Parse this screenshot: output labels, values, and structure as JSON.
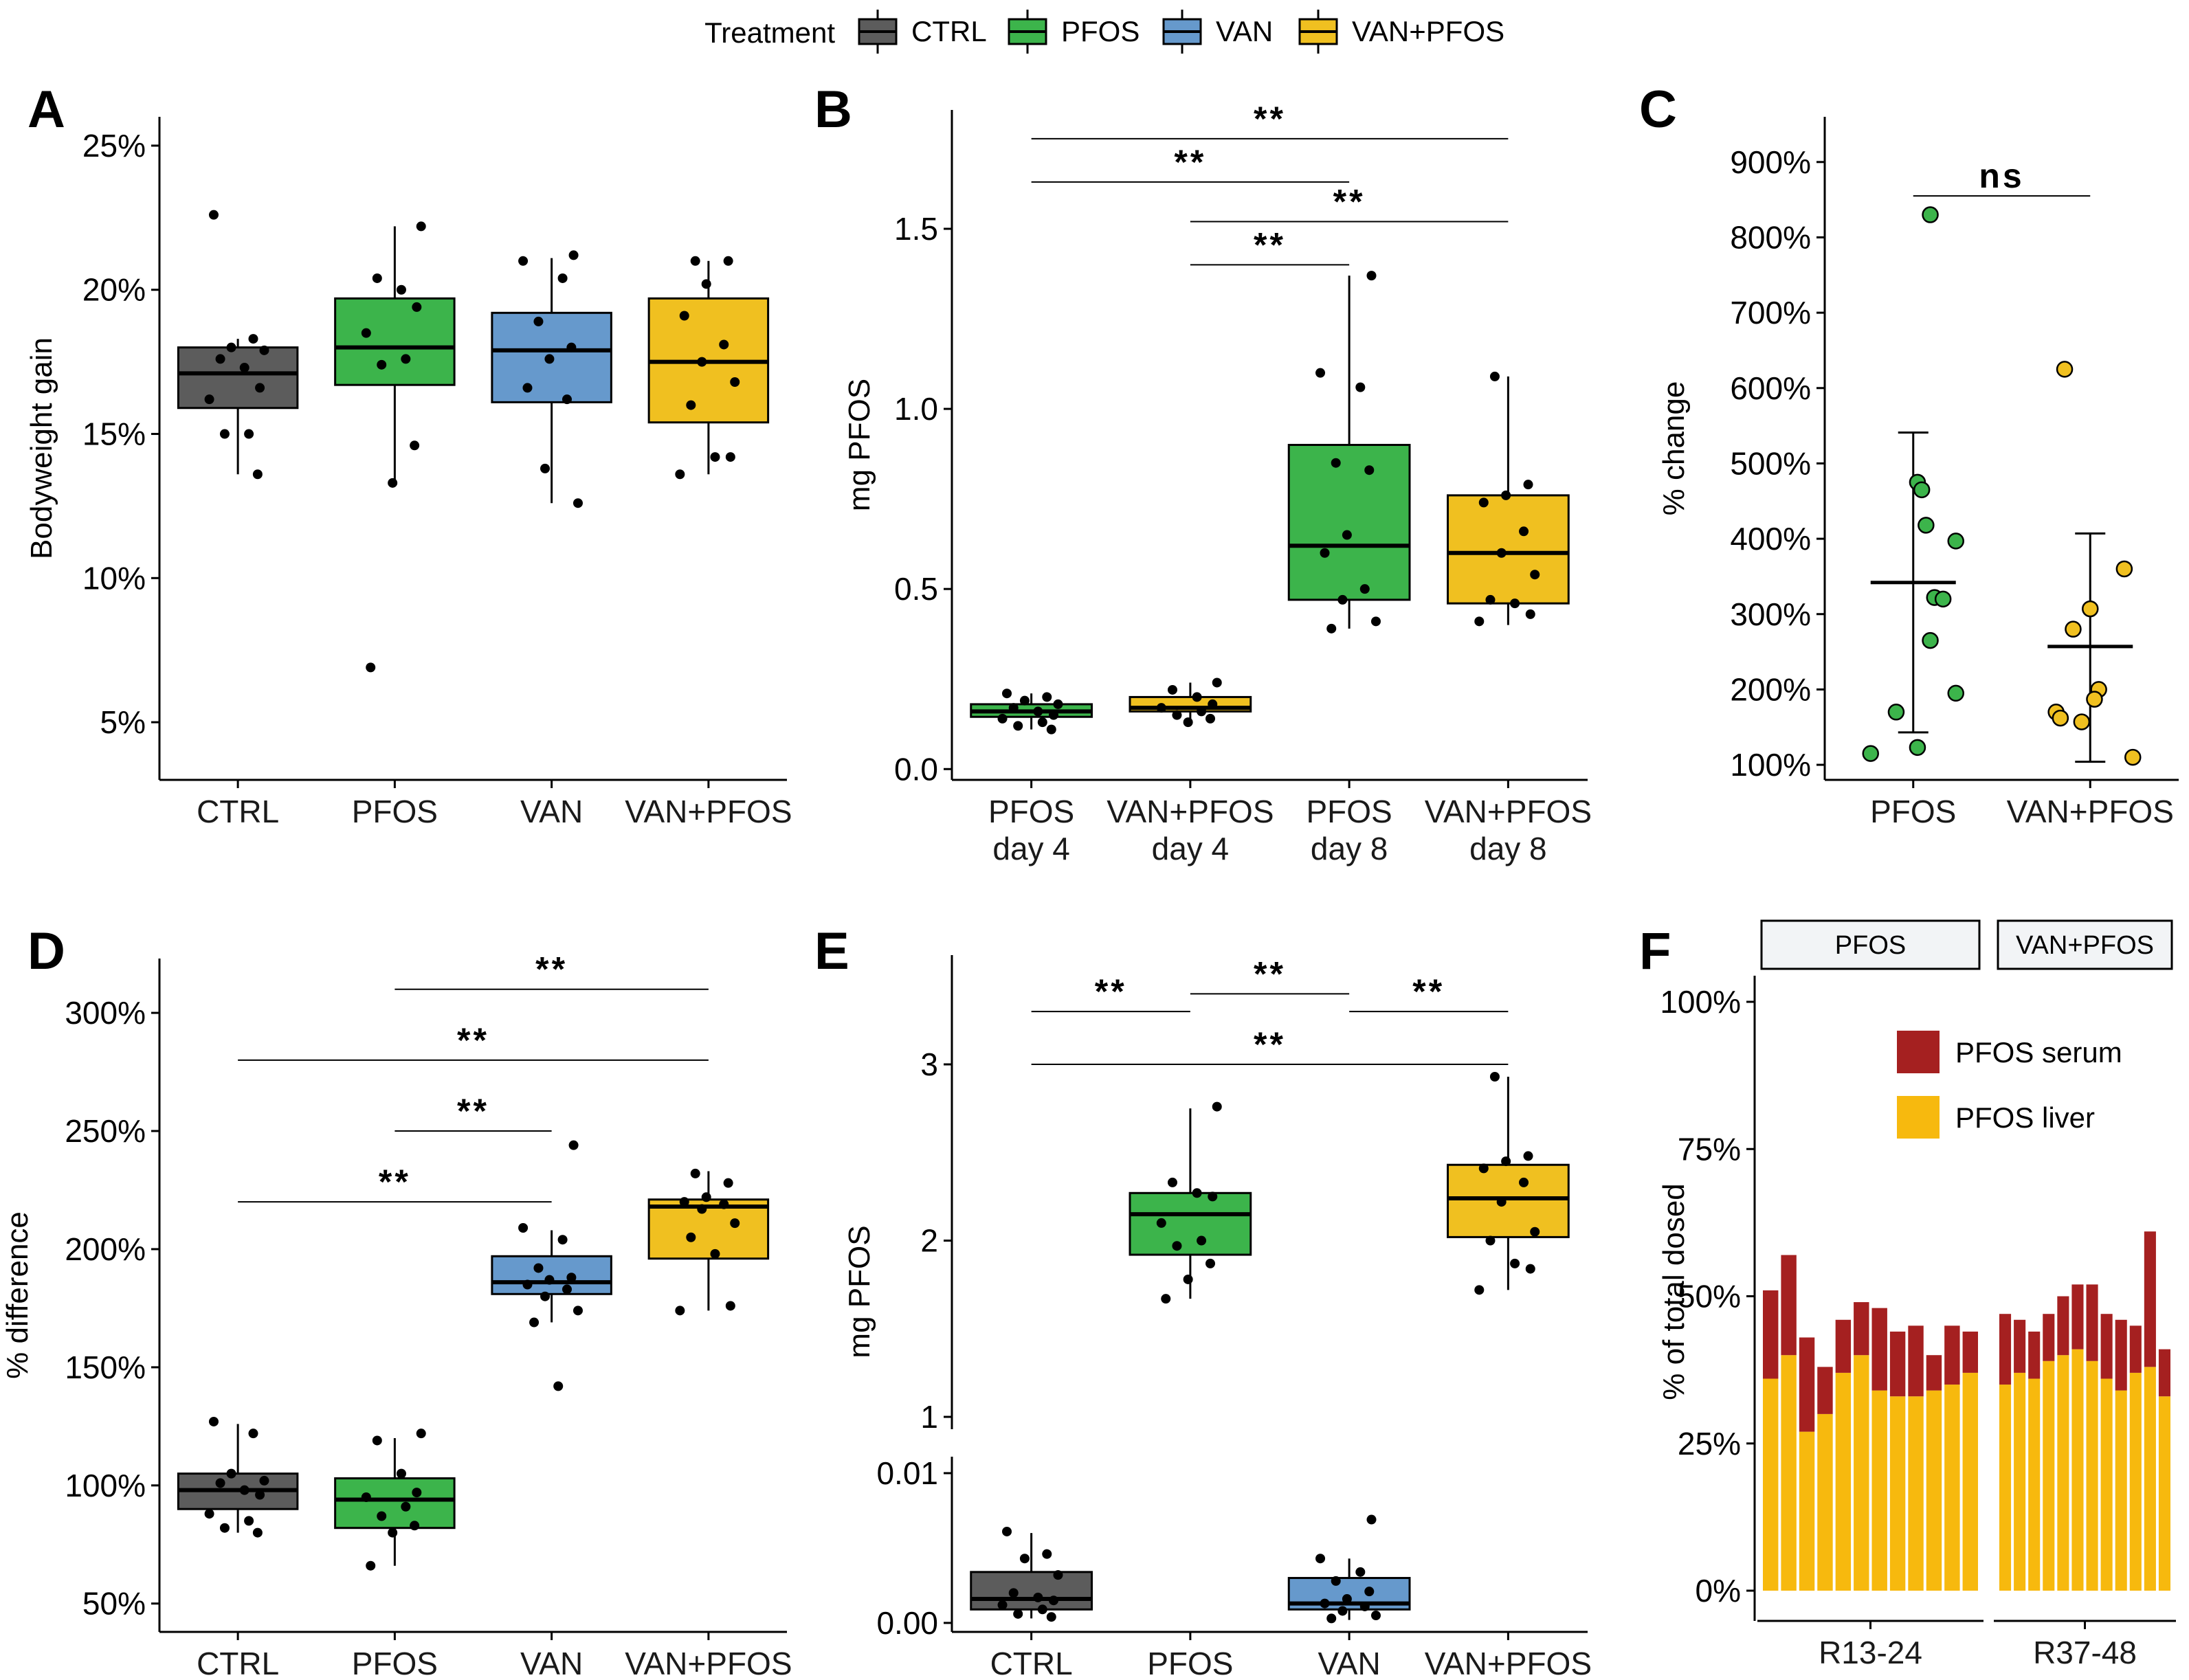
{
  "legend": {
    "title": "Treatment",
    "items": [
      {
        "label": "CTRL",
        "color": "#5c5c5c"
      },
      {
        "label": "PFOS",
        "color": "#3cb44b"
      },
      {
        "label": "VAN",
        "color": "#6699cc"
      },
      {
        "label": "VAN+PFOS",
        "color": "#f0c020"
      }
    ]
  },
  "chart_data": [
    {
      "panel": "A",
      "type": "box",
      "ylabel": "Bodyweight gain",
      "ylim": [
        3,
        26
      ],
      "yticks": [
        "5%",
        "10%",
        "15%",
        "20%",
        "25%"
      ],
      "ytick_values": [
        5,
        10,
        15,
        20,
        25
      ],
      "categories": [
        "CTRL",
        "PFOS",
        "VAN",
        "VAN+PFOS"
      ],
      "boxes": [
        {
          "q1": 15.9,
          "median": 17.1,
          "q3": 18.0,
          "lo": 13.6,
          "hi": 18.3,
          "fill": "#5c5c5c"
        },
        {
          "q1": 16.7,
          "median": 18.0,
          "q3": 19.7,
          "lo": 13.3,
          "hi": 22.2,
          "fill": "#3cb44b"
        },
        {
          "q1": 16.1,
          "median": 17.9,
          "q3": 19.2,
          "lo": 12.6,
          "hi": 21.1,
          "fill": "#6699cc"
        },
        {
          "q1": 15.4,
          "median": 17.5,
          "q3": 19.7,
          "lo": 13.6,
          "hi": 21.0,
          "fill": "#f0c020"
        }
      ],
      "points": [
        [
          22.6,
          18.3,
          18.0,
          17.9,
          17.6,
          17.3,
          16.6,
          16.2,
          15.0,
          15.0,
          13.6
        ],
        [
          22.2,
          20.4,
          20.0,
          19.4,
          18.5,
          17.6,
          17.4,
          14.6,
          13.3,
          6.9
        ],
        [
          21.2,
          21.0,
          20.4,
          18.9,
          18.0,
          17.6,
          16.6,
          16.2,
          13.8,
          12.6
        ],
        [
          21.0,
          21.0,
          20.2,
          19.1,
          18.1,
          17.5,
          16.8,
          16.0,
          14.2,
          14.2,
          13.6
        ]
      ],
      "significance": []
    },
    {
      "panel": "B",
      "type": "box",
      "ylabel": "mg PFOS",
      "ylim": [
        -0.03,
        1.83
      ],
      "yticks": [
        "0.0",
        "0.5",
        "1.0",
        "1.5"
      ],
      "ytick_values": [
        0.0,
        0.5,
        1.0,
        1.5
      ],
      "categories": [
        "PFOS\nday 4",
        "VAN+PFOS\nday 4",
        "PFOS\nday 8",
        "VAN+PFOS\nday 8"
      ],
      "boxes": [
        {
          "q1": 0.145,
          "median": 0.16,
          "q3": 0.18,
          "lo": 0.11,
          "hi": 0.21,
          "fill": "#3cb44b"
        },
        {
          "q1": 0.16,
          "median": 0.17,
          "q3": 0.2,
          "lo": 0.13,
          "hi": 0.24,
          "fill": "#f0c020"
        },
        {
          "q1": 0.47,
          "median": 0.62,
          "q3": 0.9,
          "lo": 0.39,
          "hi": 1.37,
          "fill": "#3cb44b"
        },
        {
          "q1": 0.46,
          "median": 0.6,
          "q3": 0.76,
          "lo": 0.4,
          "hi": 1.09,
          "fill": "#f0c020"
        }
      ],
      "points": [
        [
          0.21,
          0.2,
          0.19,
          0.18,
          0.17,
          0.16,
          0.15,
          0.14,
          0.13,
          0.12,
          0.11
        ],
        [
          0.24,
          0.22,
          0.2,
          0.18,
          0.17,
          0.16,
          0.15,
          0.14,
          0.13
        ],
        [
          1.37,
          1.1,
          1.06,
          0.85,
          0.83,
          0.65,
          0.6,
          0.5,
          0.47,
          0.41,
          0.39
        ],
        [
          1.09,
          0.79,
          0.76,
          0.74,
          0.66,
          0.6,
          0.54,
          0.47,
          0.46,
          0.43,
          0.41
        ]
      ],
      "significance": [
        {
          "from": 0,
          "to": 3,
          "level": 1.75,
          "label": "**"
        },
        {
          "from": 0,
          "to": 2,
          "level": 1.63,
          "label": "**"
        },
        {
          "from": 1,
          "to": 3,
          "level": 1.52,
          "label": "**"
        },
        {
          "from": 1,
          "to": 2,
          "level": 1.4,
          "label": "**"
        }
      ]
    },
    {
      "panel": "C",
      "type": "scatter_mean_sd",
      "ylabel": "% change",
      "ylim": [
        80,
        960
      ],
      "yticks": [
        "100%",
        "200%",
        "300%",
        "400%",
        "500%",
        "600%",
        "700%",
        "800%",
        "900%"
      ],
      "ytick_values": [
        100,
        200,
        300,
        400,
        500,
        600,
        700,
        800,
        900
      ],
      "categories": [
        "PFOS",
        "VAN+PFOS"
      ],
      "groups": [
        {
          "mean": 342,
          "sd_lo": 143,
          "sd_hi": 541,
          "fill": "#3cb44b",
          "points": [
            [
              0.7,
              830
            ],
            [
              0.55,
              475
            ],
            [
              0.6,
              465
            ],
            [
              0.65,
              418
            ],
            [
              1.0,
              397
            ],
            [
              0.75,
              322
            ],
            [
              0.85,
              320
            ],
            [
              0.7,
              265
            ],
            [
              1.0,
              195
            ],
            [
              0.3,
              170
            ],
            [
              0.0,
              115
            ],
            [
              0.55,
              123
            ]
          ]
        },
        {
          "mean": 257,
          "sd_lo": 104,
          "sd_hi": 407,
          "fill": "#f0c020",
          "points": [
            [
              0.2,
              625
            ],
            [
              0.9,
              360
            ],
            [
              0.5,
              307
            ],
            [
              0.3,
              280
            ],
            [
              0.6,
              200
            ],
            [
              0.55,
              187
            ],
            [
              0.1,
              170
            ],
            [
              0.15,
              162
            ],
            [
              0.4,
              157
            ],
            [
              1.0,
              110
            ]
          ]
        }
      ],
      "significance": [
        {
          "from": 0,
          "to": 1,
          "level": 855,
          "label": "ns"
        }
      ]
    },
    {
      "panel": "D",
      "type": "box",
      "ylabel": "% difference",
      "ylim": [
        38,
        323
      ],
      "yticks": [
        "50%",
        "100%",
        "150%",
        "200%",
        "250%",
        "300%"
      ],
      "ytick_values": [
        50,
        100,
        150,
        200,
        250,
        300
      ],
      "categories": [
        "CTRL",
        "PFOS",
        "VAN",
        "VAN+PFOS"
      ],
      "boxes": [
        {
          "q1": 90,
          "median": 98,
          "q3": 105,
          "lo": 80,
          "hi": 126,
          "fill": "#5c5c5c"
        },
        {
          "q1": 82,
          "median": 94,
          "q3": 103,
          "lo": 66,
          "hi": 120,
          "fill": "#3cb44b"
        },
        {
          "q1": 181,
          "median": 186,
          "q3": 197,
          "lo": 169,
          "hi": 208,
          "fill": "#6699cc"
        },
        {
          "q1": 196,
          "median": 218,
          "q3": 221,
          "lo": 174,
          "hi": 233,
          "fill": "#f0c020"
        }
      ],
      "points": [
        [
          127,
          122,
          105,
          102,
          101,
          98,
          96,
          88,
          85,
          82,
          80
        ],
        [
          122,
          119,
          105,
          97,
          95,
          91,
          87,
          83,
          80,
          66
        ],
        [
          244,
          209,
          204,
          192,
          188,
          187,
          185,
          183,
          180,
          174,
          169,
          142
        ],
        [
          232,
          228,
          222,
          220,
          219,
          217,
          211,
          205,
          198,
          176,
          174
        ]
      ],
      "significance": [
        {
          "from": 1,
          "to": 3,
          "level": 310,
          "label": "**"
        },
        {
          "from": 0,
          "to": 3,
          "level": 280,
          "label": "**"
        },
        {
          "from": 1,
          "to": 2,
          "level": 250,
          "label": "**"
        },
        {
          "from": 0,
          "to": 2,
          "level": 220,
          "label": "**"
        }
      ]
    },
    {
      "panel": "E",
      "type": "box_broken_axis",
      "ylabel": "mg PFOS",
      "categories": [
        "CTRL",
        "PFOS",
        "VAN",
        "VAN+PFOS"
      ],
      "upper": {
        "ylim": [
          0.93,
          3.62
        ],
        "yticks": [
          "1",
          "2",
          "3"
        ],
        "ytick_values": [
          1,
          2,
          3
        ]
      },
      "lower": {
        "ylim": [
          -0.0006,
          0.0111
        ],
        "yticks": [
          "0.00",
          "0.01"
        ],
        "ytick_values": [
          0.0,
          0.01
        ]
      },
      "boxes": [
        {
          "segment": "lower",
          "q1": 0.0009,
          "median": 0.0016,
          "q3": 0.0034,
          "lo": 0.0003,
          "hi": 0.006,
          "fill": "#5c5c5c"
        },
        {
          "segment": "upper",
          "q1": 1.92,
          "median": 2.15,
          "q3": 2.27,
          "lo": 1.67,
          "hi": 2.75,
          "fill": "#3cb44b"
        },
        {
          "segment": "lower",
          "q1": 0.0009,
          "median": 0.0013,
          "q3": 0.003,
          "lo": 0.0002,
          "hi": 0.0043,
          "fill": "#6699cc"
        },
        {
          "segment": "upper",
          "q1": 2.02,
          "median": 2.24,
          "q3": 2.43,
          "lo": 1.72,
          "hi": 2.93,
          "fill": "#f0c020"
        }
      ],
      "points": [
        [
          0.0061,
          0.0046,
          0.0043,
          0.0032,
          0.002,
          0.0017,
          0.0015,
          0.0012,
          0.0009,
          0.0006,
          0.0004
        ],
        [
          2.76,
          2.33,
          2.27,
          2.25,
          2.1,
          2.0,
          1.97,
          1.87,
          1.78,
          1.67
        ],
        [
          0.0069,
          0.0043,
          0.0034,
          0.0028,
          0.0021,
          0.0016,
          0.0013,
          0.0011,
          0.0008,
          0.0005,
          0.0003
        ],
        [
          2.93,
          2.48,
          2.45,
          2.41,
          2.33,
          2.22,
          2.05,
          2.0,
          1.87,
          1.84,
          1.72
        ]
      ],
      "significance": [
        {
          "from": 0,
          "to": 1,
          "level": 3.3,
          "label": "**"
        },
        {
          "from": 1,
          "to": 2,
          "level": 3.4,
          "label": "**"
        },
        {
          "from": 2,
          "to": 3,
          "level": 3.3,
          "label": "**"
        },
        {
          "from": 0,
          "to": 3,
          "level": 3.0,
          "label": "**"
        }
      ]
    },
    {
      "panel": "F",
      "type": "stacked_bar",
      "ylabel": "% of total dosed",
      "ylim": [
        0,
        100
      ],
      "yticks": [
        "0%",
        "25%",
        "50%",
        "75%",
        "100%"
      ],
      "ytick_values": [
        0,
        25,
        50,
        75,
        100
      ],
      "series": [
        {
          "name": "PFOS serum",
          "color": "#a52020"
        },
        {
          "name": "PFOS liver",
          "color": "#f7b90e"
        }
      ],
      "facets": [
        {
          "strip": "PFOS",
          "xlabel": "R13-24",
          "liver": [
            36,
            40,
            27,
            30,
            37,
            40,
            34,
            33,
            33,
            34,
            35,
            37
          ],
          "serum": [
            15,
            17,
            16,
            8,
            9,
            9,
            14,
            11,
            12,
            6,
            10,
            7
          ]
        },
        {
          "strip": "VAN+PFOS",
          "xlabel": "R37-48",
          "liver": [
            35,
            37,
            36,
            39,
            40,
            41,
            39,
            36,
            34,
            37,
            38,
            33
          ],
          "serum": [
            12,
            9,
            8,
            8,
            10,
            11,
            13,
            11,
            12,
            8,
            23,
            8
          ]
        }
      ]
    }
  ]
}
